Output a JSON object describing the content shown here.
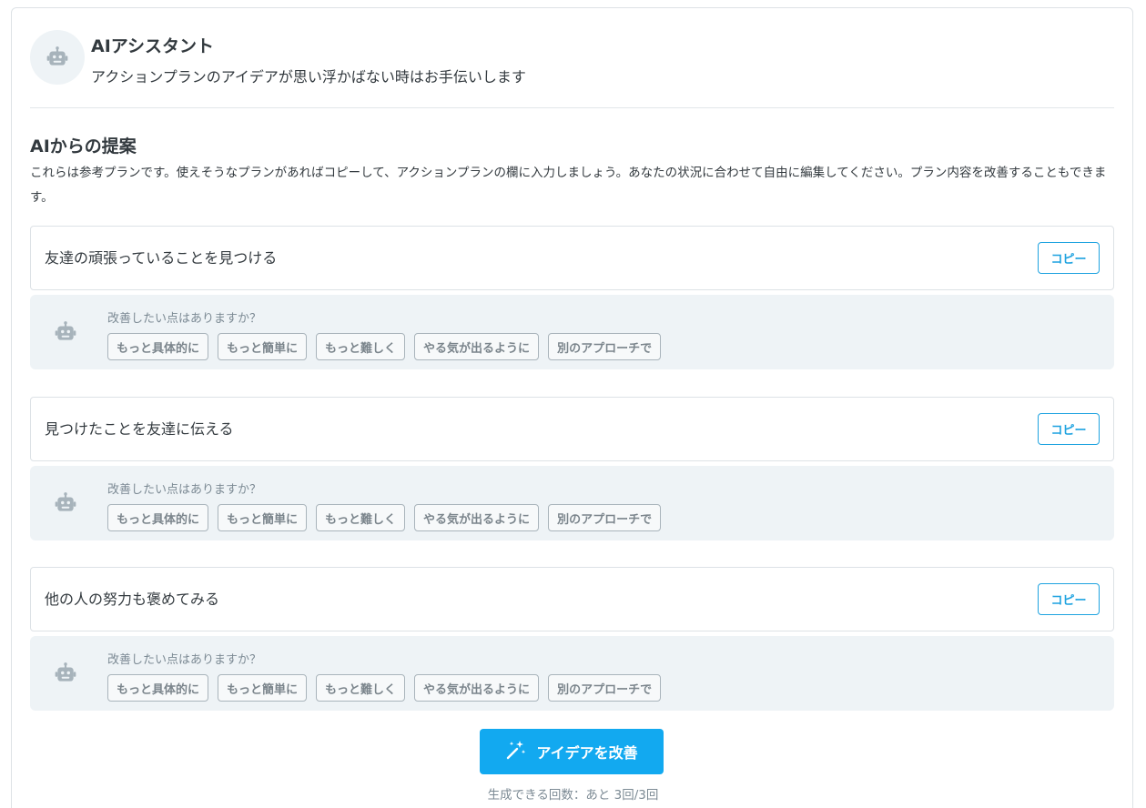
{
  "header": {
    "title": "AIアシスタント",
    "subtitle": "アクションプランのアイデアが思い浮かばない時はお手伝いします"
  },
  "suggestions": {
    "title": "AIからの提案",
    "description": "これらは参考プランです。使えそうなプランがあればコピーして、アクションプランの欄に入力しましょう。あなたの状況に合わせて自由に編集してください。プラン内容を改善することもできます。"
  },
  "plans": [
    {
      "text": "友達の頑張っていることを見つける",
      "copy_label": "コピー"
    },
    {
      "text": "見つけたことを友達に伝える",
      "copy_label": "コピー"
    },
    {
      "text": "他の人の努力も褒めてみる",
      "copy_label": "コピー"
    }
  ],
  "improve": {
    "question": "改善したい点はありますか？",
    "options": [
      "もっと具体的に",
      "もっと簡単に",
      "もっと難しく",
      "やる気が出るように",
      "別のアプローチで"
    ]
  },
  "actions": {
    "improve_button": "アイデアを改善",
    "remaining_text": "生成できる回数：あと 3回/3回"
  },
  "colors": {
    "accent": "#12a9f0",
    "copy_button": "#1fa3e0",
    "improve_bg": "#eef3f6"
  },
  "icons": {
    "assistant": "robot-icon",
    "improve_button": "magic-wand-icon"
  }
}
